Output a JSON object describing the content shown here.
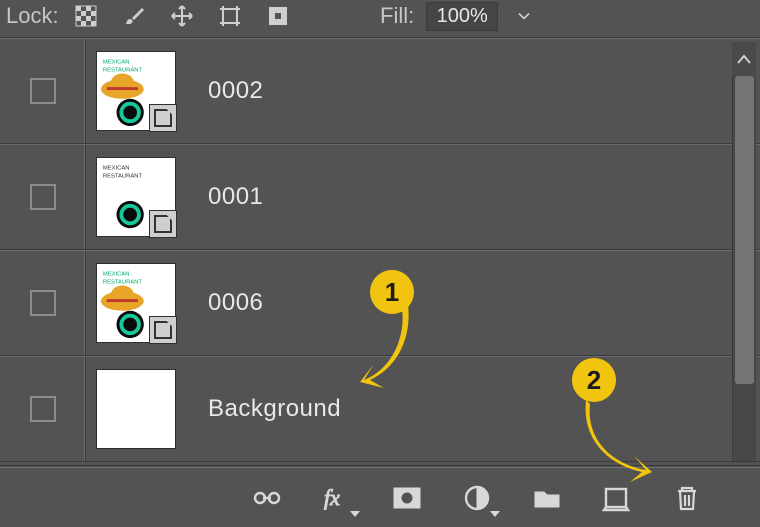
{
  "topbar": {
    "lock_label": "Lock:",
    "fill_label": "Fill:",
    "fill_value": "100%"
  },
  "layers": [
    {
      "name": "0002",
      "smart": true,
      "thumb": "hat"
    },
    {
      "name": "0001",
      "smart": true,
      "thumb": "plain"
    },
    {
      "name": "0006",
      "smart": true,
      "thumb": "hat"
    },
    {
      "name": "Background",
      "smart": false,
      "thumb": "blank"
    }
  ],
  "annotations": {
    "a1": "1",
    "a2": "2"
  }
}
